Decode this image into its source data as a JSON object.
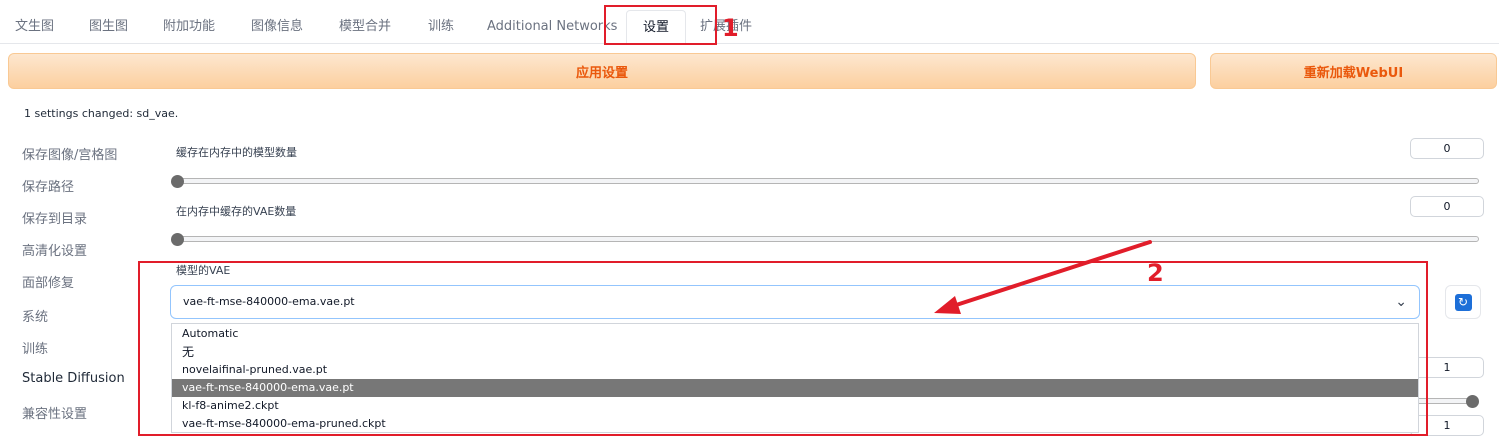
{
  "tabs": [
    {
      "label": "文生图"
    },
    {
      "label": "图生图"
    },
    {
      "label": "附加功能"
    },
    {
      "label": "图像信息"
    },
    {
      "label": "模型合并"
    },
    {
      "label": "训练"
    },
    {
      "label": "Additional Networks"
    },
    {
      "label": "设置"
    },
    {
      "label": "扩展插件"
    }
  ],
  "actions": {
    "apply": "应用设置",
    "reload": "重新加载WebUI"
  },
  "status_text": "1 settings changed: sd_vae.",
  "nav": [
    {
      "label": "保存图像/宫格图"
    },
    {
      "label": "保存路径"
    },
    {
      "label": "保存到目录"
    },
    {
      "label": "高清化设置"
    },
    {
      "label": "面部修复"
    },
    {
      "label": "系统"
    },
    {
      "label": "训练"
    },
    {
      "label": "Stable Diffusion"
    },
    {
      "label": "兼容性设置"
    }
  ],
  "settings": {
    "cache_models": {
      "label": "缓存在内存中的模型数量",
      "value": "0"
    },
    "cache_vae": {
      "label": "在内存中缓存的VAE数量",
      "value": "0"
    },
    "sd_vae": {
      "label": "模型的VAE",
      "value": "vae-ft-mse-840000-ema.vae.pt",
      "options": [
        "Automatic",
        "无",
        "novelaifinal-pruned.vae.pt",
        "vae-ft-mse-840000-ema.vae.pt",
        "kl-f8-anime2.ckpt",
        "vae-ft-mse-840000-ema-pruned.ckpt"
      ]
    },
    "hidden_values": {
      "first": "1",
      "second": "1"
    }
  },
  "annotations": {
    "step1": "1",
    "step2": "2",
    "color": "#e11d2a"
  },
  "icons": {
    "refresh": "refresh-icon",
    "chevron": "chevron-down-icon"
  }
}
